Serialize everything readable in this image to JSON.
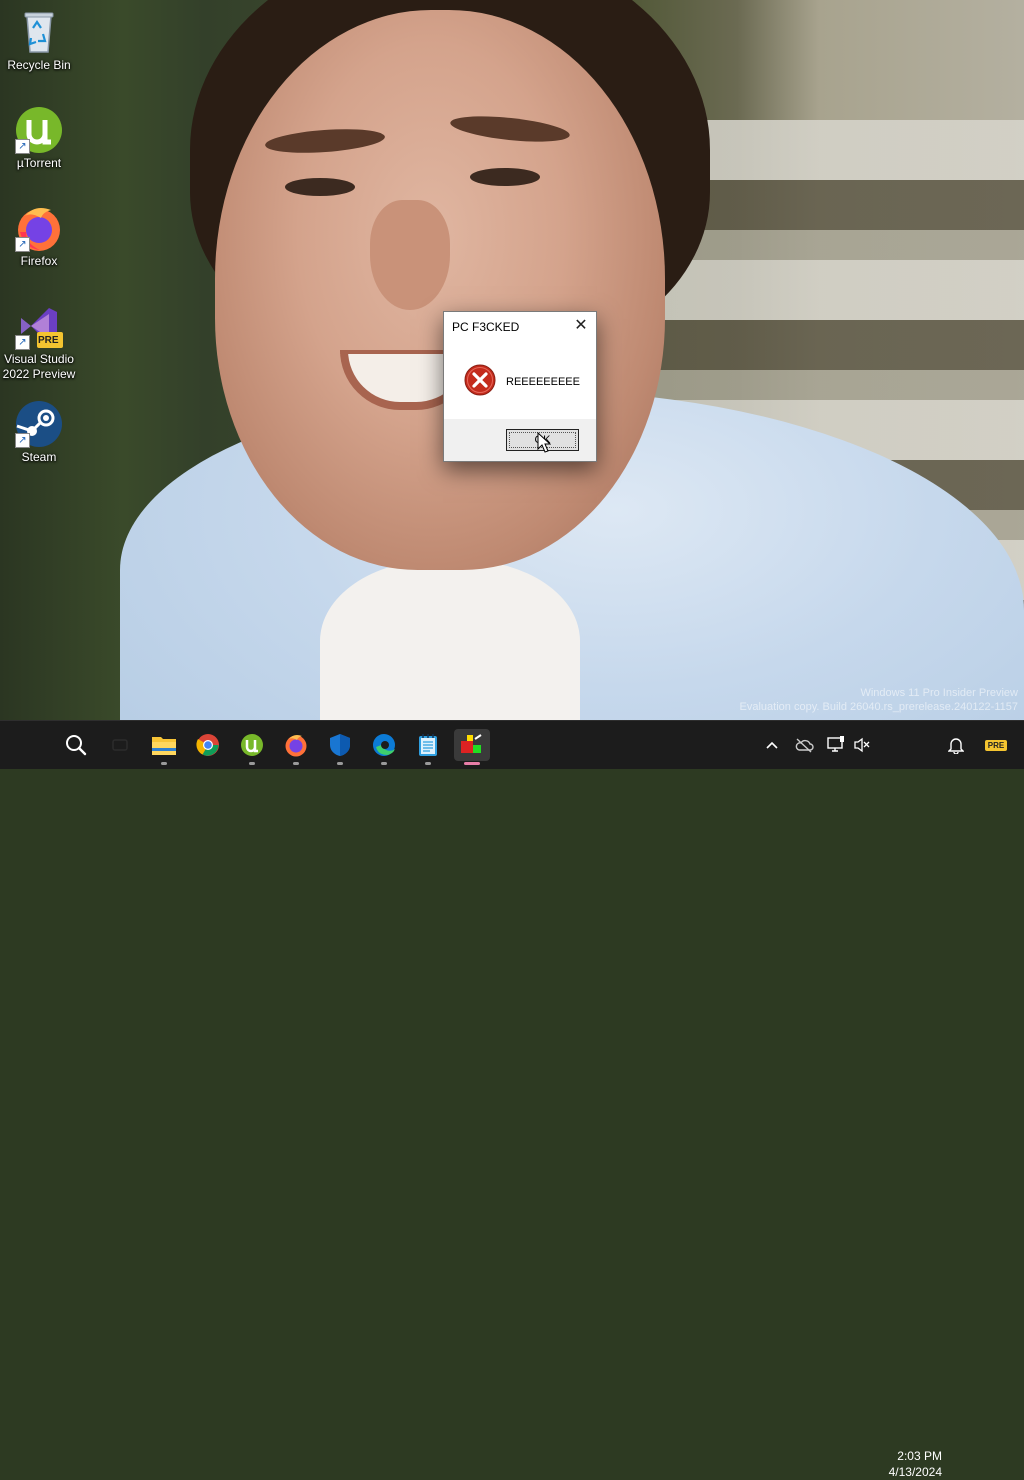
{
  "desktop": {
    "icons": [
      {
        "label": "Recycle Bin",
        "icon": "recycle-bin-icon"
      },
      {
        "label": "µTorrent",
        "icon": "utorrent-icon"
      },
      {
        "label": "Firefox",
        "icon": "firefox-icon"
      },
      {
        "label_line1": "Visual Studio",
        "label_line2": "2022 Preview",
        "icon": "visual-studio-icon",
        "badge": "PRE"
      },
      {
        "label": "Steam",
        "icon": "steam-icon"
      }
    ]
  },
  "dialog": {
    "title": "PC F3CKED",
    "message": "REEEEEEEEE",
    "button_label": "OK",
    "close_glyph": "✕",
    "icon": "error-icon"
  },
  "watermark": {
    "line1": "Windows 11 Pro Insider Preview",
    "line2": "Evaluation copy. Build 26040.rs_prerelease.240122-1157"
  },
  "taskbar": {
    "apps": [
      "search-icon",
      "task-view-icon",
      "file-explorer-icon",
      "chrome-icon",
      "utorrent-icon",
      "firefox-icon",
      "defender-icon",
      "edge-icon",
      "notepad-icon",
      "app-icon"
    ],
    "active_app": "app-icon",
    "tray_icons": [
      "chevron-up-icon",
      "onedrive-icon",
      "network-icon",
      "volume-muted-icon",
      "notification-bell-icon",
      "pre-badge-icon"
    ],
    "tray_badge": "PRE",
    "clock": {
      "time": "2:03 PM",
      "date": "4/13/2024"
    }
  },
  "colors": {
    "taskbar_bg": "#1c1c1c",
    "dialog_bg": "#f0f0f0",
    "error_red": "#c42b1c",
    "active_indicator": "#e87ea8"
  }
}
